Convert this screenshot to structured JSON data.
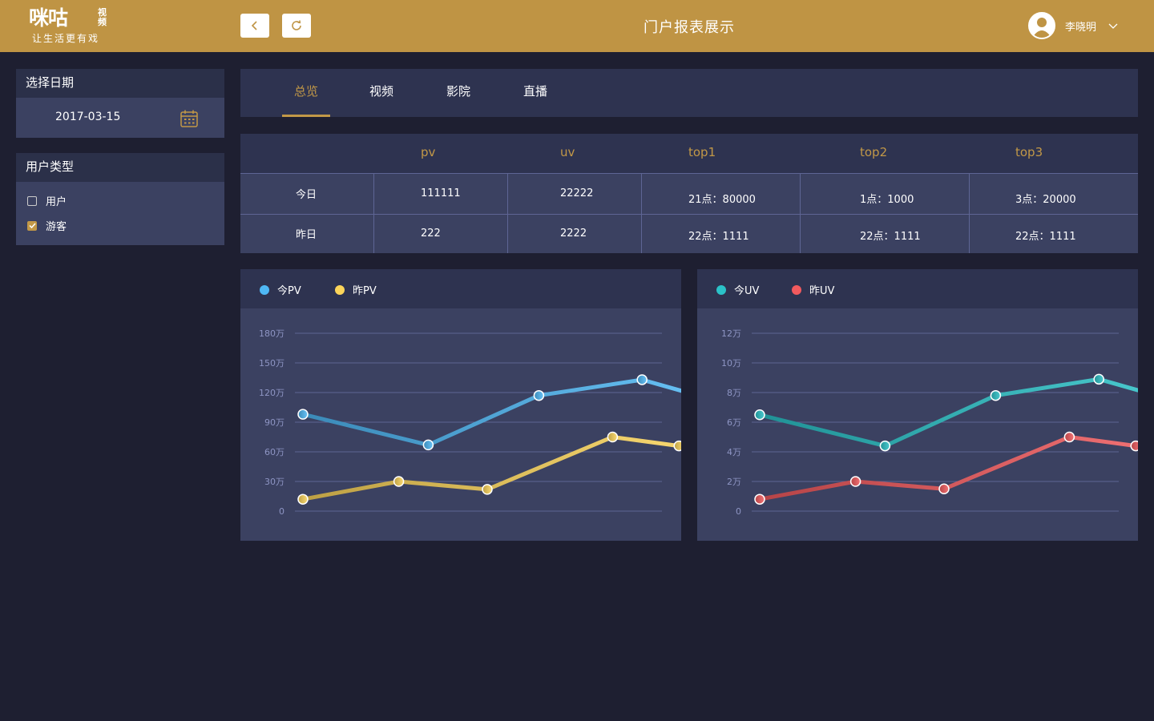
{
  "header": {
    "logo_main": "咪咕",
    "logo_side": "视频",
    "logo_slogan": "让生活更有戏",
    "title": "门户报表展示",
    "user_name": "李晓明",
    "accent": "#bf9444"
  },
  "sidebar": {
    "date_title": "选择日期",
    "date_value": "2017-03-15",
    "type_title": "用户类型",
    "types": [
      {
        "label": "用户",
        "checked": false
      },
      {
        "label": "游客",
        "checked": true
      }
    ]
  },
  "tabs": [
    {
      "label": "总览",
      "active": true
    },
    {
      "label": "视频",
      "active": false
    },
    {
      "label": "影院",
      "active": false
    },
    {
      "label": "直播",
      "active": false
    }
  ],
  "stats": {
    "headers": [
      "pv",
      "uv",
      "top1",
      "top2",
      "top3"
    ],
    "rows": [
      {
        "label": "今日",
        "cells": [
          "111111",
          "22222",
          "21点：80000",
          "1点：1000",
          "3点：20000"
        ]
      },
      {
        "label": "昨日",
        "cells": [
          "222",
          "2222",
          "22点：1111",
          "22点：1111",
          "22点：1111"
        ]
      }
    ]
  },
  "chart_data": [
    {
      "type": "line",
      "ylim": [
        0,
        1800000
      ],
      "yticks": [
        "0",
        "30万",
        "60万",
        "90万",
        "120万",
        "150万",
        "180万"
      ],
      "grid": true,
      "legend": "top-left",
      "series": [
        {
          "name": "今PV",
          "color": "#4fb8f5",
          "x": [
            0,
            1.7,
            3.2,
            4.6,
            5.6
          ],
          "values": [
            980000,
            670000,
            1170000,
            1330000,
            1120000
          ]
        },
        {
          "name": "昨PV",
          "color": "#fcd55a",
          "x": [
            0,
            1.3,
            2.5,
            4.2,
            5.1,
            5.6
          ],
          "values": [
            120000,
            300000,
            220000,
            750000,
            660000,
            890000
          ]
        }
      ]
    },
    {
      "type": "line",
      "ylim": [
        0,
        120000
      ],
      "yticks": [
        "0",
        "2万",
        "4万",
        "6万",
        "8万",
        "10万",
        "12万"
      ],
      "grid": true,
      "legend": "top-left",
      "series": [
        {
          "name": "今UV",
          "color": "#2bc2c8",
          "x": [
            0,
            1.7,
            3.2,
            4.6,
            5.6
          ],
          "values": [
            65000,
            44000,
            78000,
            89000,
            75000
          ]
        },
        {
          "name": "昨UV",
          "color": "#f25a5e",
          "x": [
            0,
            1.3,
            2.5,
            4.2,
            5.1,
            5.6
          ],
          "values": [
            8000,
            20000,
            15000,
            50000,
            44000,
            20000
          ]
        }
      ]
    }
  ]
}
